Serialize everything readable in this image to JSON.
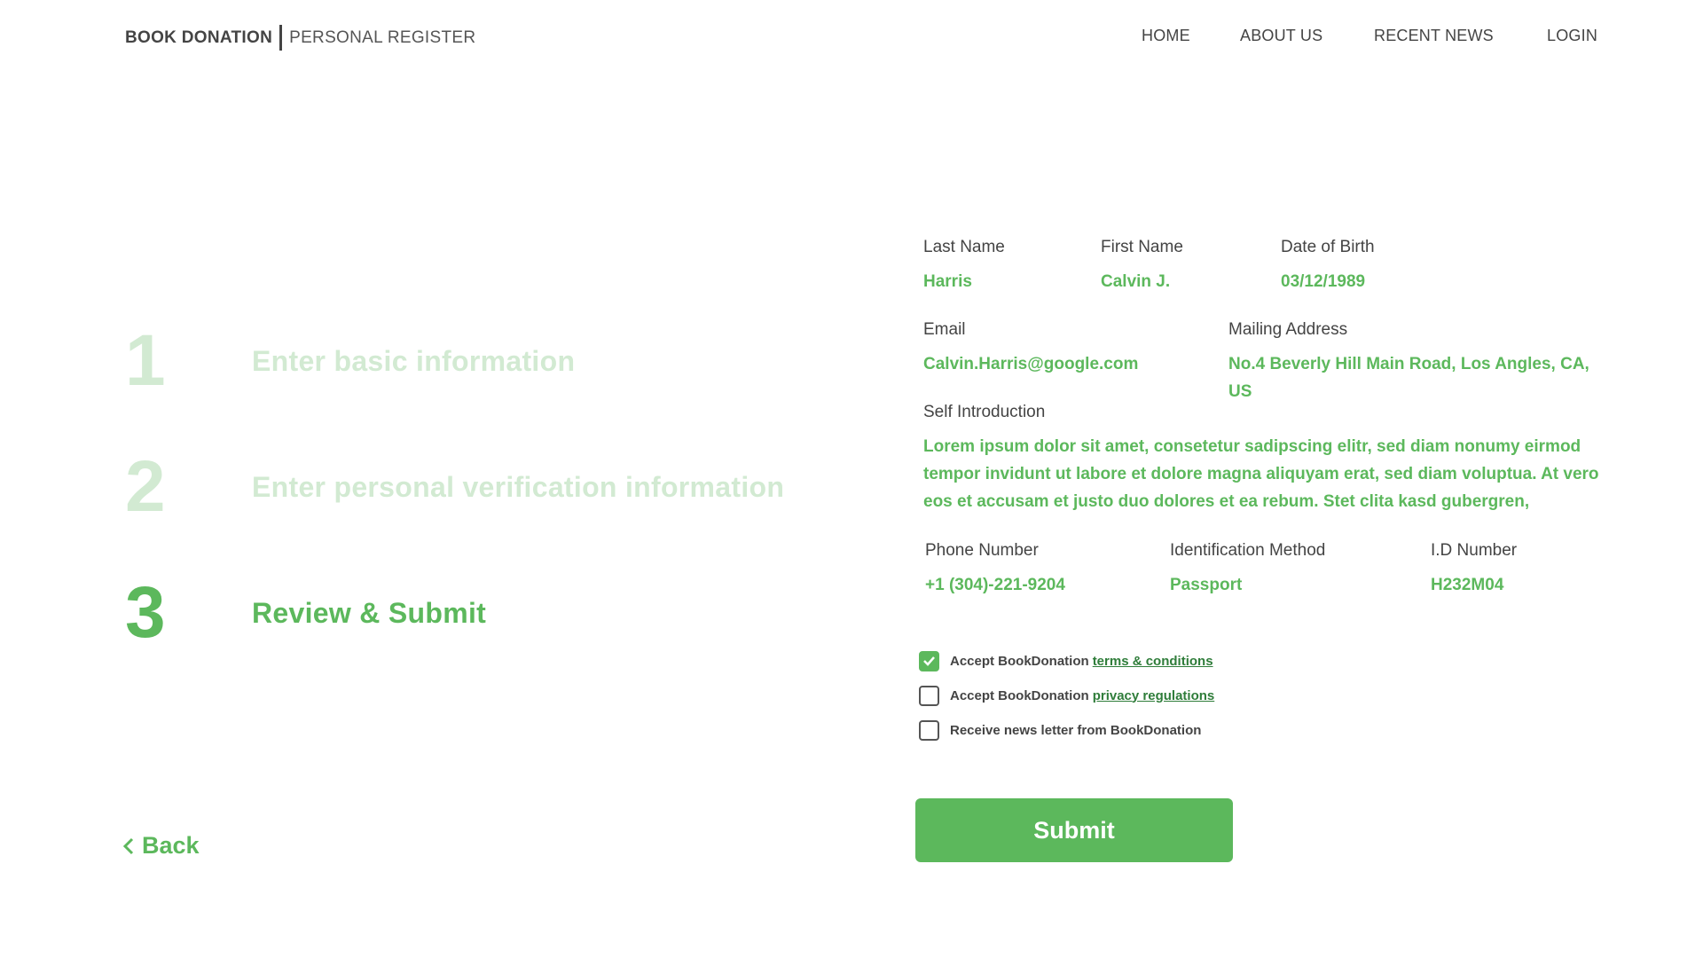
{
  "header": {
    "brand_strong": "BOOK DONATION",
    "brand_light": "PERSONAL REGISTER",
    "nav": [
      "HOME",
      "ABOUT US",
      "RECENT NEWS",
      "LOGIN"
    ]
  },
  "steps": [
    {
      "number": "1",
      "label": "Enter basic information",
      "state": "done"
    },
    {
      "number": "2",
      "label": "Enter personal verification information",
      "state": "done"
    },
    {
      "number": "3",
      "label": "Review & Submit",
      "state": "active"
    }
  ],
  "back_label": "Back",
  "review": {
    "last_name": {
      "label": "Last Name",
      "value": "Harris"
    },
    "first_name": {
      "label": "First Name",
      "value": "Calvin J."
    },
    "dob": {
      "label": "Date of Birth",
      "value": "03/12/1989"
    },
    "email": {
      "label": "Email",
      "value": "Calvin.Harris@google.com"
    },
    "address": {
      "label": "Mailing Address",
      "value": "No.4 Beverly Hill Main Road, Los Angles, CA, US"
    },
    "intro": {
      "label": "Self Introduction",
      "value": "Lorem ipsum dolor sit amet, consetetur sadipscing elitr, sed diam nonumy eirmod tempor invidunt ut labore et dolore magna aliquyam erat, sed diam voluptua. At vero eos et accusam et justo duo dolores et ea rebum. Stet clita kasd gubergren,"
    },
    "phone": {
      "label": "Phone Number",
      "value": "+1 (304)-221-9204"
    },
    "id_method": {
      "label": "Identification Method",
      "value": "Passport"
    },
    "id_number": {
      "label": "I.D Number",
      "value": "H232M04"
    }
  },
  "checkboxes": [
    {
      "text": "Accept BookDonation",
      "link": "terms & conditions",
      "checked": true
    },
    {
      "text": "Accept BookDonation",
      "link": "privacy regulations",
      "checked": false
    },
    {
      "text": "Receive news letter from BookDonation",
      "link": "",
      "checked": false
    }
  ],
  "submit_label": "Submit",
  "colors": {
    "accent": "#5cb85c",
    "accent_light": "#d2ead2",
    "link": "#2f7d3a",
    "text": "#444444"
  }
}
